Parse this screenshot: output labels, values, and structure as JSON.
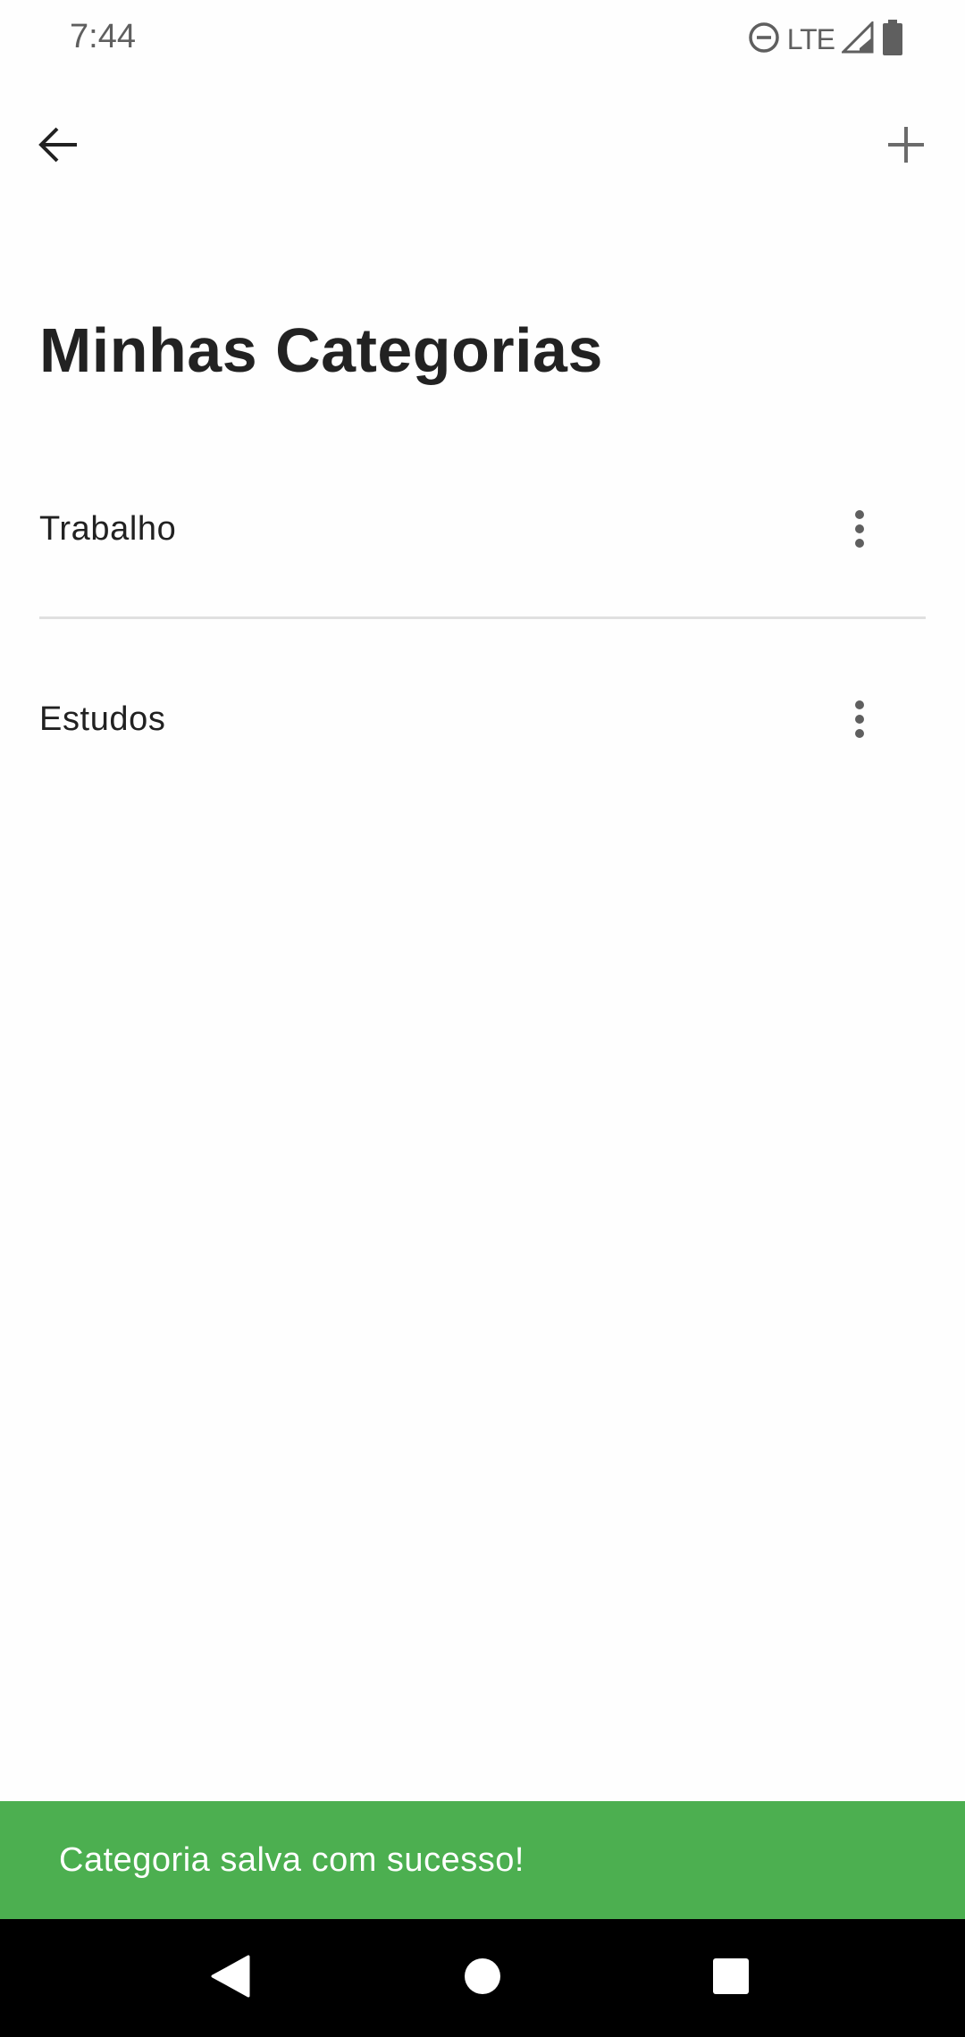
{
  "status_bar": {
    "time": "7:44",
    "network": "LTE",
    "icons": [
      "do-not-disturb-icon",
      "signal-icon",
      "battery-icon"
    ]
  },
  "app_bar": {
    "back_icon": "arrow-back-icon",
    "add_icon": "plus-icon"
  },
  "page": {
    "title": "Minhas Categorias"
  },
  "categories": [
    {
      "label": "Trabalho",
      "menu_icon": "more-vertical-icon"
    },
    {
      "label": "Estudos",
      "menu_icon": "more-vertical-icon"
    }
  ],
  "snackbar": {
    "message": "Categoria salva com sucesso!",
    "color": "#4caf50"
  },
  "nav_bar": {
    "icons": [
      "back-triangle-icon",
      "home-circle-icon",
      "recents-square-icon"
    ]
  }
}
